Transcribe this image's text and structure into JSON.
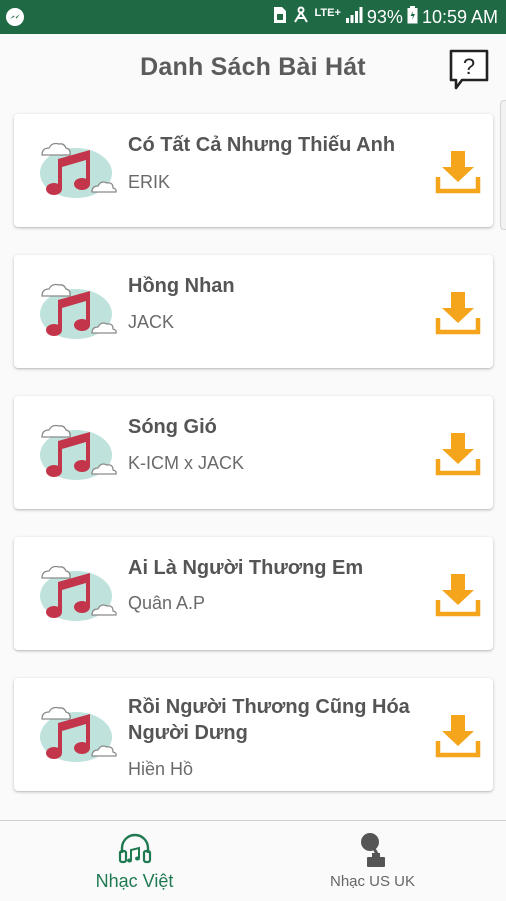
{
  "status_bar": {
    "lte": "LTE+",
    "battery": "93%",
    "time": "10:59 AM"
  },
  "header": {
    "title": "Danh Sách Bài Hát",
    "help_glyph": "?"
  },
  "songs": [
    {
      "title": "Có Tất Cả Nhưng Thiếu Anh",
      "artist": "ERIK"
    },
    {
      "title": "Hồng Nhan",
      "artist": "JACK"
    },
    {
      "title": "Sóng Gió",
      "artist": "K-ICM x JACK"
    },
    {
      "title": "Ai Là Người Thương Em",
      "artist": "Quân A.P"
    },
    {
      "title": "Rồi Người Thương Cũng Hóa Người Dưng",
      "artist": "Hiền Hồ"
    }
  ],
  "bottom_nav": {
    "tabs": [
      {
        "label": "Nhạc Việt",
        "icon": "headphones-music-icon",
        "active": true
      },
      {
        "label": "Nhạc US UK",
        "icon": "gramophone-icon",
        "active": false
      }
    ]
  },
  "colors": {
    "status_bar": "#1f6a45",
    "accent_green": "#1f7a52",
    "download_orange": "#f4a51c",
    "note_red": "#c3354a",
    "cloud_mint": "#bfe3dc"
  }
}
